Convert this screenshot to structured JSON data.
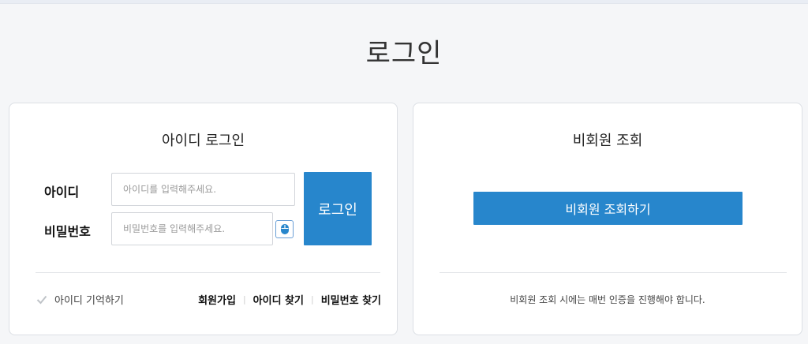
{
  "page": {
    "title": "로그인"
  },
  "member_login": {
    "title": "아이디 로그인",
    "id_label": "아이디",
    "id_placeholder": "아이디를 입력해주세요.",
    "pw_label": "비밀번호",
    "pw_placeholder": "비밀번호를 입력해주세요.",
    "login_button": "로그인",
    "remember_label": "아이디 기억하기",
    "remember_checked": true,
    "links": [
      "회원가입",
      "아이디 찾기",
      "비밀번호 찾기"
    ]
  },
  "guest_lookup": {
    "title": "비회원 조회",
    "button": "비회원 조회하기",
    "note": "비회원 조회 시에는 매번 인증을 진행해야 합니다."
  },
  "colors": {
    "primary": "#2786cc",
    "background": "#f5f6f8",
    "border": "#dcdfe4"
  },
  "icons": {
    "virtual_keyboard": "mouse-icon",
    "remember_check": "checkmark-icon"
  }
}
